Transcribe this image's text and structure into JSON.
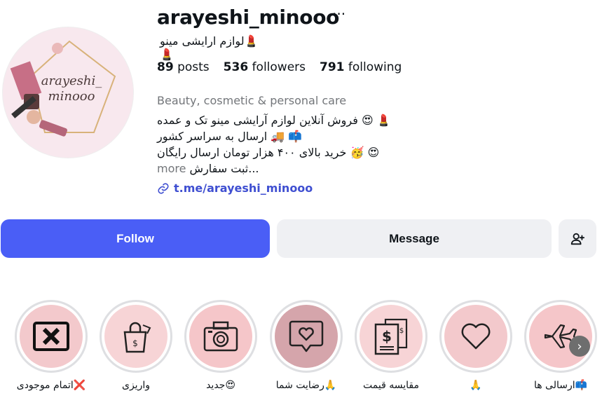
{
  "profile": {
    "username": "arayeshi_minooo",
    "more_glyph": "···",
    "full_name": "💄لوازم ارایشی مینو💄",
    "avatar_text_line1": "arayeshi_",
    "avatar_text_line2": "minooo",
    "stats": {
      "posts_count": "89",
      "posts_label": "posts",
      "followers_count": "536",
      "followers_label": "followers",
      "following_count": "791",
      "following_label": "following"
    },
    "category": "Beauty, cosmetic & personal care",
    "bio": {
      "line1": "💄 😍 فروش آنلاین لوازم آرایشی مینو تک و عمده",
      "line2": "📫 🚚 ارسال به سراسر کشور",
      "line3": "😍 🥳 خرید بالای ۴۰۰ هزار تومان ارسال رایگان",
      "line4": "...ثبت سفارش",
      "more": "more"
    },
    "link": "t.me/arayeshi_minooo"
  },
  "actions": {
    "follow": "Follow",
    "message": "Message"
  },
  "highlights": [
    {
      "label": "❌اتمام موجودی",
      "icon": "x-box-icon"
    },
    {
      "label": "واریزی",
      "icon": "shopping-bag-icon"
    },
    {
      "label": "😍جدید",
      "icon": "camera-icon"
    },
    {
      "label": "🙏رضایت شما",
      "icon": "heart-message-icon"
    },
    {
      "label": "مقایسه قیمت",
      "icon": "price-tags-icon"
    },
    {
      "label": "🙏",
      "icon": "heart-icon"
    },
    {
      "label": "📫ارسالی ها",
      "icon": "airplane-icon"
    }
  ],
  "colors": {
    "accent": "#4a5ef6",
    "link": "#3f4fd1",
    "muted": "#73767a",
    "highlight_pink": "#f5c6c9",
    "highlight_mauve": "#d5a5ab"
  }
}
